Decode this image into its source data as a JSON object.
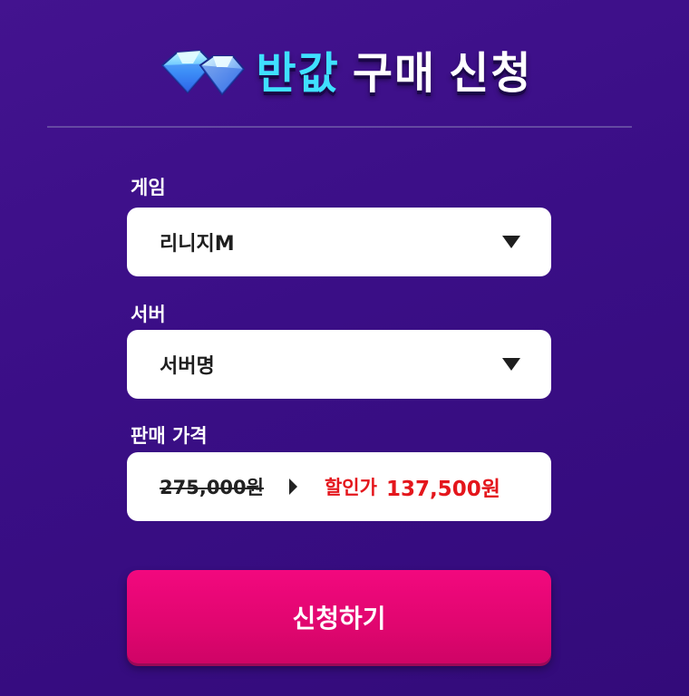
{
  "header": {
    "title_accent": "반값",
    "title_main_1": "구매",
    "title_main_2": "신청",
    "gem_icon": "diamond-icon",
    "accent_color": "#3fe0ff"
  },
  "form": {
    "game": {
      "label": "게임",
      "value": "리니지M"
    },
    "server": {
      "label": "서버",
      "value": "서버명"
    },
    "price": {
      "label": "판매 가격",
      "original": "275,000원",
      "sale_label": "할인가",
      "sale_value": "137,500원",
      "sale_color": "#e4161c"
    },
    "submit_label": "신청하기",
    "submit_color": "#f2087e"
  }
}
